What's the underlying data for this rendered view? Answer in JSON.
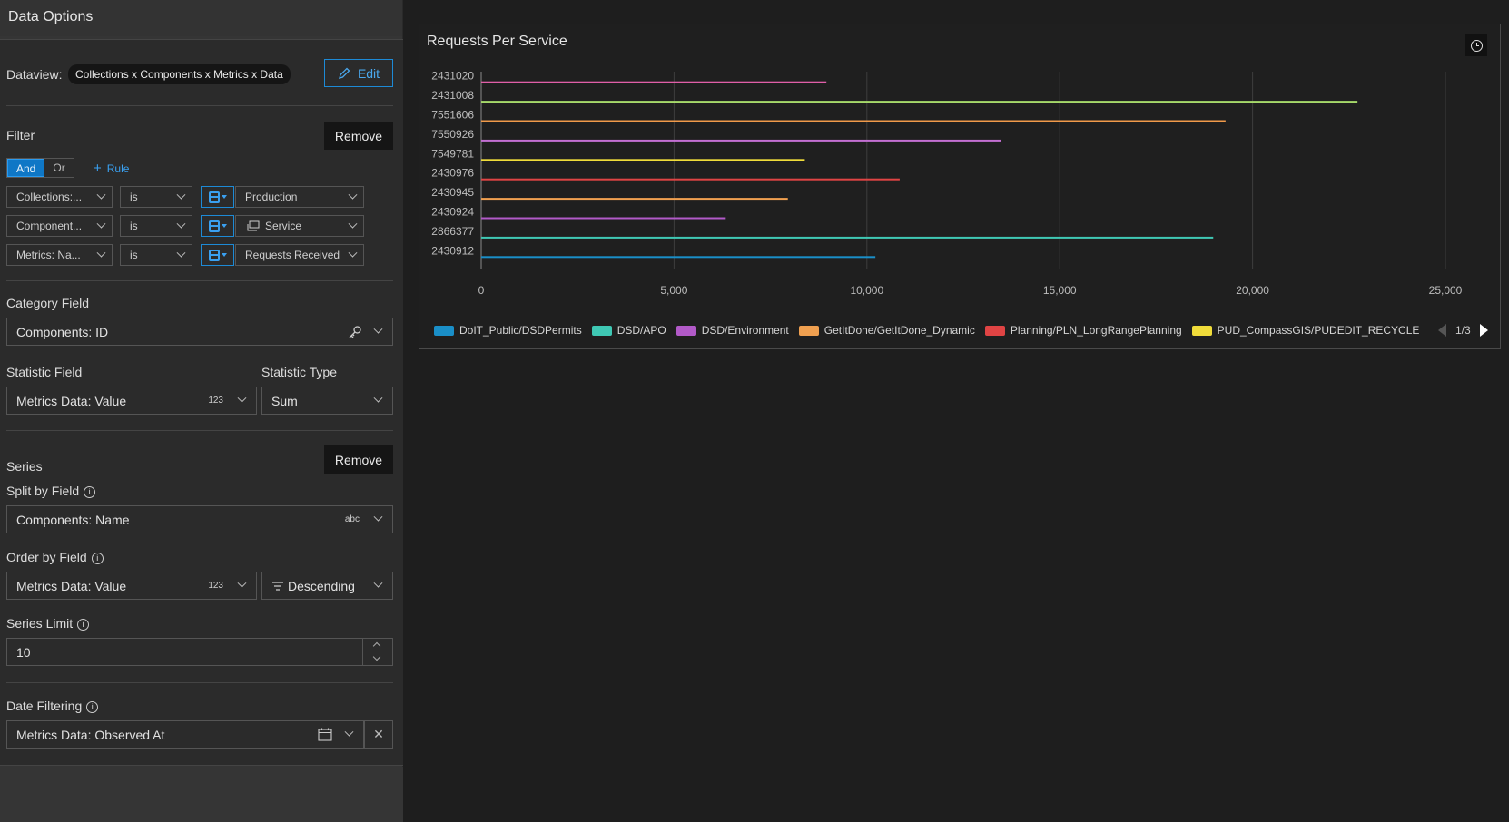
{
  "panel": {
    "title": "Data Options",
    "dataview": {
      "label": "Dataview:",
      "value": "Collections x Components x Metrics x Data",
      "edit_label": "Edit"
    },
    "filter": {
      "label": "Filter",
      "remove_label": "Remove",
      "logic": {
        "and": "And",
        "or": "Or",
        "selected": "And"
      },
      "add_rule_label": "Rule",
      "rules": [
        {
          "field": "Collections:...",
          "operator": "is",
          "value": "Production"
        },
        {
          "field": "Component...",
          "operator": "is",
          "value": "Service"
        },
        {
          "field": "Metrics: Na...",
          "operator": "is",
          "value": "Requests Received"
        }
      ]
    },
    "category": {
      "label": "Category Field",
      "value": "Components: ID"
    },
    "statistic": {
      "field_label": "Statistic Field",
      "field_value": "Metrics Data: Value",
      "field_type": "123",
      "type_label": "Statistic Type",
      "type_value": "Sum"
    },
    "series": {
      "label": "Series",
      "remove_label": "Remove",
      "split_label": "Split by Field",
      "split_value": "Components: Name",
      "split_type": "abc",
      "order_label": "Order by Field",
      "order_value": "Metrics Data: Value",
      "order_type": "123",
      "order_direction": "Descending",
      "limit_label": "Series Limit",
      "limit_value": "10"
    },
    "date": {
      "label": "Date Filtering",
      "value": "Metrics Data: Observed At"
    }
  },
  "chart_data": {
    "type": "bar",
    "orientation": "horizontal",
    "title": "Requests Per Service",
    "categories": [
      "2431020",
      "2431008",
      "7551606",
      "7550926",
      "7549781",
      "2430976",
      "2430945",
      "2430924",
      "2866377",
      "2430912"
    ],
    "values": [
      8950,
      22720,
      19300,
      13480,
      8390,
      10850,
      7950,
      6340,
      18980,
      10220
    ],
    "bar_colors": [
      "#e05fa8",
      "#a6d96a",
      "#f09a4a",
      "#c36fd2",
      "#f0dc3a",
      "#e04444",
      "#f0a050",
      "#b25ac8",
      "#3fc8b4",
      "#1a8fc8"
    ],
    "x_ticks": [
      "0",
      "5,000",
      "10,000",
      "15,000",
      "20,000",
      "25,000"
    ],
    "xlim": [
      0,
      25000
    ],
    "grid": true,
    "legend": {
      "placement": "bottom",
      "items": [
        {
          "name": "DoIT_Public/DSDPermits",
          "color": "#1a8fc8"
        },
        {
          "name": "DSD/APO",
          "color": "#3fc8b4"
        },
        {
          "name": "DSD/Environment",
          "color": "#b25ac8"
        },
        {
          "name": "GetItDone/GetItDone_Dynamic",
          "color": "#f0a050"
        },
        {
          "name": "Planning/PLN_LongRangePlanning",
          "color": "#e04444"
        },
        {
          "name": "PUD_CompassGIS/PUDEDIT_RECYCLE",
          "color": "#f0dc3a"
        }
      ],
      "page": "1/3"
    }
  }
}
